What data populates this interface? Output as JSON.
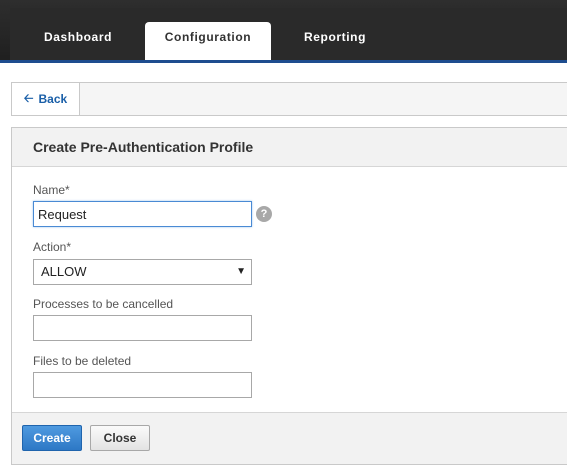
{
  "nav": {
    "tabs": [
      {
        "label": "Dashboard"
      },
      {
        "label": "Configuration"
      },
      {
        "label": "Reporting"
      }
    ],
    "active": "Configuration"
  },
  "back": {
    "icon": "back-arrow-icon",
    "label": "Back"
  },
  "panel": {
    "title": "Create Pre-Authentication Profile",
    "fields": {
      "name": {
        "label": "Name*",
        "value": "Request"
      },
      "action": {
        "label": "Action*",
        "value": "ALLOW"
      },
      "processes": {
        "label": "Processes to be cancelled",
        "value": ""
      },
      "files": {
        "label": "Files to be deleted",
        "value": ""
      }
    },
    "help_icon": "?",
    "buttons": {
      "create": "Create",
      "close": "Close"
    }
  },
  "colors": {
    "accent": "#2d78c5",
    "nav_bg": "#2a2a2a",
    "nav_line": "#1e4d8f",
    "link": "#1a5fa8"
  }
}
